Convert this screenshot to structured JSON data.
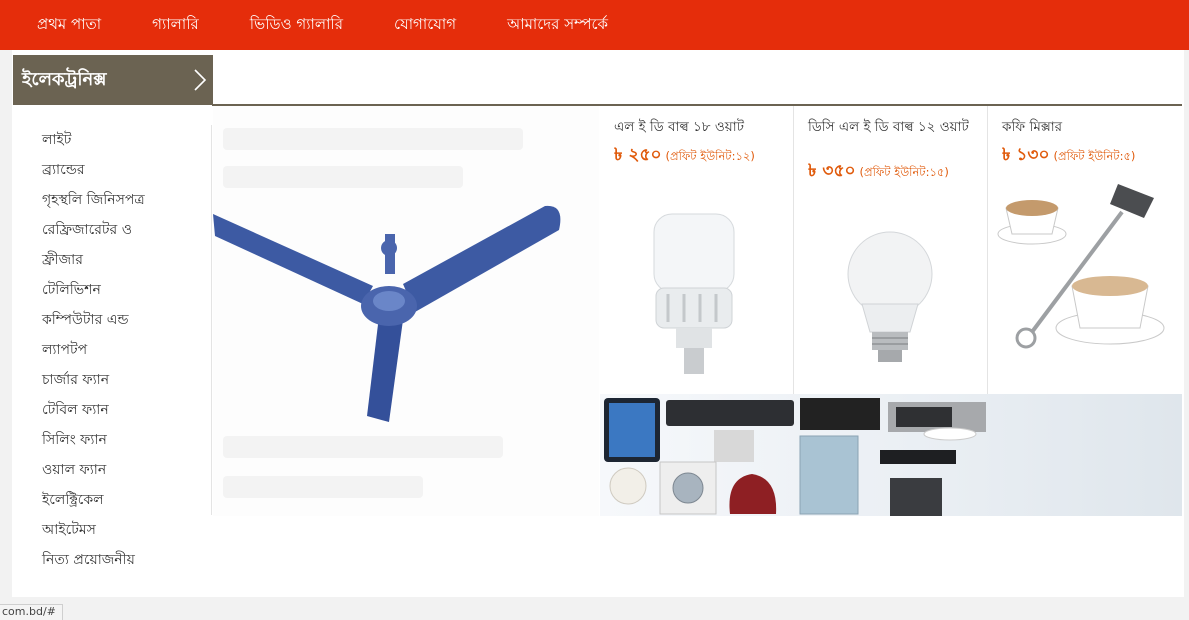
{
  "nav": {
    "items": [
      "প্রথম পাতা",
      "গ্যালারি",
      "ভিডিও গ্যালারি",
      "যোগাযোগ",
      "আমাদের সম্পর্কে"
    ]
  },
  "sidebar": {
    "header": "ইলেকট্রনিক্স",
    "items": [
      "লাইট",
      "ব্র্যান্ডের",
      "গৃহস্থলি জিনিসপত্র",
      "রেফ্রিজারেটর ও",
      "ফ্রীজার",
      "টেলিভিশন",
      "কম্পিউটার এন্ড",
      "ল্যাপটপ",
      "চার্জার ফ্যান",
      "টেবিল ফ্যান",
      "সিলিং ফ্যান",
      "ওয়াল ফ্যান",
      "ইলেক্ট্রিকেল",
      "আইটেমস",
      "নিত্য প্রয়োজনীয়"
    ]
  },
  "products": [
    {
      "name": "এল ই ডি বাল্ব ১৮ ওয়াট",
      "price": "৳ ২৫০",
      "profit": "(প্রফিট ইউনিট:১২)"
    },
    {
      "name": "ডিসি এল ই ডি বাল্ব ১২ ওয়াট",
      "price": "৳ ৩৫০",
      "profit": "(প্রফিট ইউনিট:১৫)"
    },
    {
      "name": "কফি মিক্সার",
      "price": "৳ ১৩০",
      "profit": "(প্রফিট ইউনিট:৫)"
    }
  ],
  "status": {
    "url": "com.bd/#"
  },
  "colors": {
    "nav_bg": "#e52d0b",
    "sidebar_header_bg": "#6b6352",
    "price": "#e05a0b",
    "fan_blue": "#3d5aa3"
  },
  "icons": [
    "chevron-right-icon"
  ]
}
